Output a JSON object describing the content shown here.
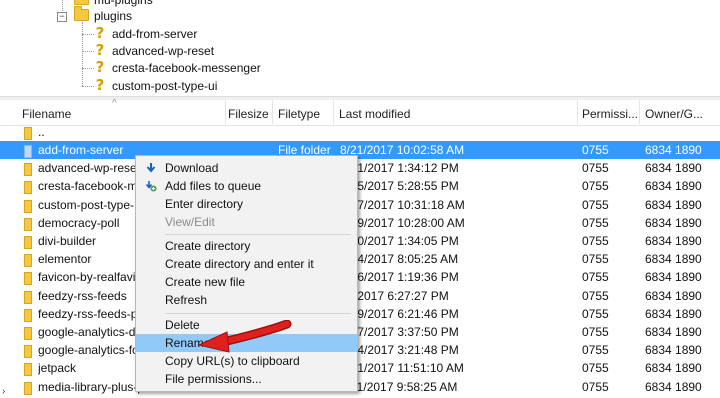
{
  "tree": {
    "items": [
      {
        "label": "mu-plugins",
        "type": "folder"
      },
      {
        "label": "plugins",
        "type": "folder"
      },
      {
        "label": "add-from-server",
        "type": "unknown"
      },
      {
        "label": "advanced-wp-reset",
        "type": "unknown"
      },
      {
        "label": "cresta-facebook-messenger",
        "type": "unknown"
      },
      {
        "label": "custom-post-type-ui",
        "type": "unknown"
      }
    ],
    "collapse_glyph": "−"
  },
  "list": {
    "columns": {
      "filename": "Filename",
      "filesize": "Filesize",
      "filetype": "Filetype",
      "modified": "Last modified",
      "permissions": "Permissi...",
      "owner": "Owner/G..."
    },
    "parent_label": "..",
    "rows": [
      {
        "name": "add-from-server",
        "type": "File folder",
        "modified": "8/21/2017 10:02:58 AM",
        "perm": "0755",
        "owner": "6834 1890"
      },
      {
        "name": "advanced-wp-reset",
        "type": "",
        "modified": "/1/2017 1:34:12 PM",
        "perm": "0755",
        "owner": "6834 1890"
      },
      {
        "name": "cresta-facebook-m",
        "type": "",
        "modified": "/5/2017 5:28:55 PM",
        "perm": "0755",
        "owner": "6834 1890"
      },
      {
        "name": "custom-post-type-",
        "type": "",
        "modified": "/7/2017 10:31:18 AM",
        "perm": "0755",
        "owner": "6834 1890"
      },
      {
        "name": "democracy-poll",
        "type": "",
        "modified": "/9/2017 10:28:00 AM",
        "perm": "0755",
        "owner": "6834 1890"
      },
      {
        "name": "divi-builder",
        "type": "",
        "modified": "/0/2017 1:34:05 PM",
        "perm": "0755",
        "owner": "6834 1890"
      },
      {
        "name": "elementor",
        "type": "",
        "modified": "/4/2017 8:05:25 AM",
        "perm": "0755",
        "owner": "6834 1890"
      },
      {
        "name": "favicon-by-realfavi",
        "type": "",
        "modified": "/6/2017 1:19:36 PM",
        "perm": "0755",
        "owner": "6834 1890"
      },
      {
        "name": "feedzy-rss-feeds",
        "type": "",
        "modified": "/2017 6:27:27 PM",
        "perm": "0755",
        "owner": "6834 1890"
      },
      {
        "name": "feedzy-rss-feeds-p",
        "type": "",
        "modified": "/9/2017 6:21:46 PM",
        "perm": "0755",
        "owner": "6834 1890"
      },
      {
        "name": "google-analytics-d",
        "type": "",
        "modified": "/7/2017 3:37:50 PM",
        "perm": "0755",
        "owner": "6834 1890"
      },
      {
        "name": "google-analytics-fo",
        "type": "",
        "modified": "/4/2017 3:21:48 PM",
        "perm": "0755",
        "owner": "6834 1890"
      },
      {
        "name": "jetpack",
        "type": "",
        "modified": "/1/2017 11:51:10 AM",
        "perm": "0755",
        "owner": "6834 1890"
      },
      {
        "name": "media-library-plus-pro",
        "type": "File folder",
        "modified": "8/21/2017 9:58:25 AM",
        "perm": "0755",
        "owner": "6834 1890"
      }
    ]
  },
  "context_menu": {
    "items": [
      {
        "label": "Download",
        "icon": "download-arrow-icon"
      },
      {
        "label": "Add files to queue",
        "icon": "add-to-queue-icon"
      },
      {
        "label": "Enter directory"
      },
      {
        "label": "View/Edit",
        "disabled": true
      },
      {
        "label": "Create directory"
      },
      {
        "label": "Create directory and enter it"
      },
      {
        "label": "Create new file"
      },
      {
        "label": "Refresh"
      },
      {
        "label": "Delete"
      },
      {
        "label": "Rename",
        "highlighted": true
      },
      {
        "label": "Copy URL(s) to clipboard"
      },
      {
        "label": "File permissions..."
      }
    ]
  },
  "colors": {
    "selection": "#3399ff",
    "menu_highlight": "#91c9f7",
    "folder": "#f5c842",
    "annotation_arrow": "#e0201c"
  },
  "left_arrow_glyph": "›"
}
